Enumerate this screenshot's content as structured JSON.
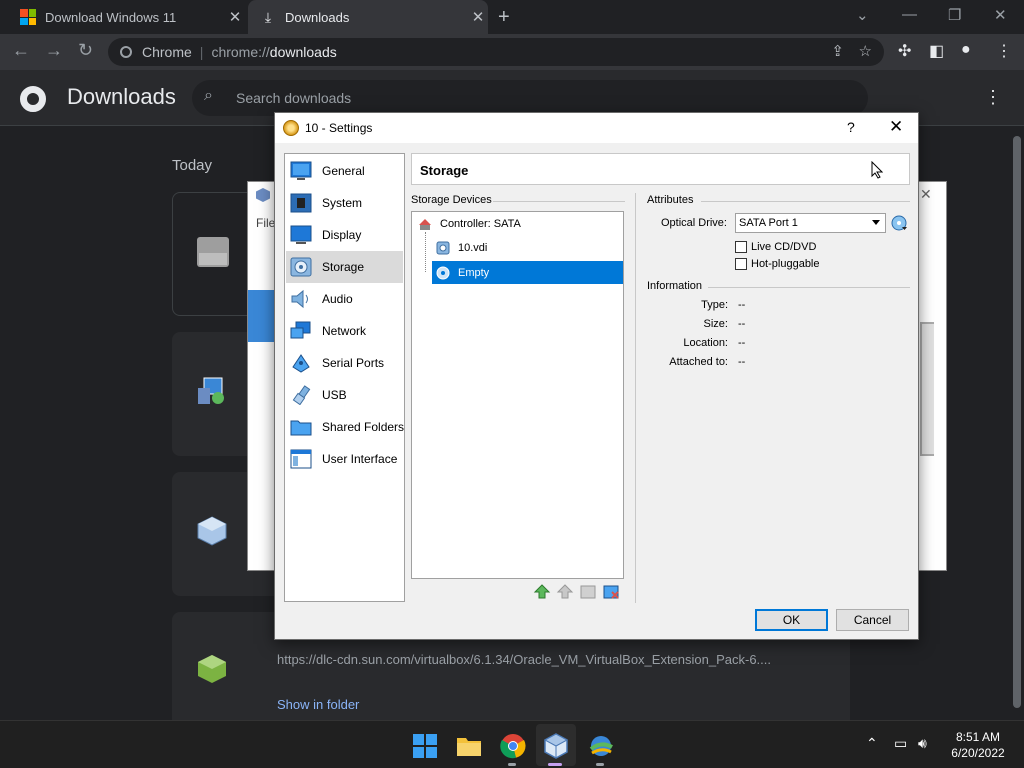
{
  "browser": {
    "tabs": [
      {
        "title": "Download Windows 11"
      },
      {
        "title": "Downloads"
      }
    ],
    "omnibox": {
      "chrome_label": "Chrome",
      "url_scheme": "chrome://",
      "url_host": "downloads"
    }
  },
  "downloads_page": {
    "title": "Downloads",
    "search_placeholder": "Search downloads",
    "section_label": "Today",
    "visible_item": {
      "url": "https://dlc-cdn.sun.com/virtualbox/6.1.34/Oracle_VM_VirtualBox_Extension_Pack-6....",
      "link_label": "Show in folder"
    }
  },
  "vbox_manager": {
    "menu_partial": "File"
  },
  "settings_dialog": {
    "title": "10 - Settings",
    "help_label": "?",
    "categories": [
      {
        "label": "General",
        "icon": "general-icon"
      },
      {
        "label": "System",
        "icon": "system-icon"
      },
      {
        "label": "Display",
        "icon": "display-icon"
      },
      {
        "label": "Storage",
        "icon": "storage-icon"
      },
      {
        "label": "Audio",
        "icon": "audio-icon"
      },
      {
        "label": "Network",
        "icon": "network-icon"
      },
      {
        "label": "Serial Ports",
        "icon": "serial-ports-icon"
      },
      {
        "label": "USB",
        "icon": "usb-icon"
      },
      {
        "label": "Shared Folders",
        "icon": "shared-folders-icon"
      },
      {
        "label": "User Interface",
        "icon": "user-interface-icon"
      }
    ],
    "selected_category": "Storage",
    "section_title": "Storage",
    "storage_devices": {
      "label": "Storage Devices",
      "controller": "Controller: SATA",
      "items": [
        {
          "label": "10.vdi",
          "icon": "hard-disk-icon"
        },
        {
          "label": "Empty",
          "icon": "optical-disc-icon",
          "selected": true
        }
      ]
    },
    "attributes": {
      "label": "Attributes",
      "optical_drive_label": "Optical Drive:",
      "optical_drive_value": "SATA Port 1",
      "live_cd_label": "Live CD/DVD",
      "live_cd_checked": false,
      "hot_pluggable_label": "Hot-pluggable",
      "hot_pluggable_checked": false
    },
    "information": {
      "label": "Information",
      "rows": [
        {
          "label": "Type:",
          "value": "--"
        },
        {
          "label": "Size:",
          "value": "--"
        },
        {
          "label": "Location:",
          "value": "--"
        },
        {
          "label": "Attached to:",
          "value": "--"
        }
      ]
    },
    "buttons": {
      "ok": "OK",
      "cancel": "Cancel"
    }
  },
  "taskbar": {
    "apps": [
      "start-icon",
      "file-explorer-icon",
      "chrome-icon",
      "virtualbox-icon",
      "network-app-icon"
    ],
    "clock": {
      "time": "8:51 AM",
      "date": "6/20/2022"
    }
  }
}
